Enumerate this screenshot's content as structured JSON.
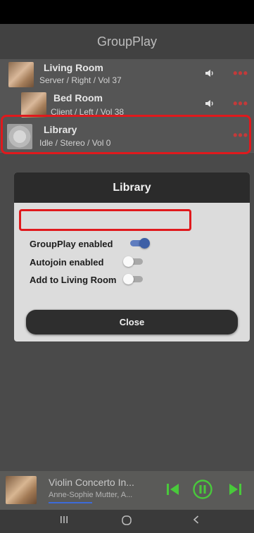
{
  "app": {
    "title": "GroupPlay"
  },
  "devices": [
    {
      "name": "Living Room",
      "status": "Server / Right / Vol 37",
      "thumb": "album-art"
    },
    {
      "name": "Bed Room",
      "status": "Client / Left / Vol 38",
      "thumb": "album-art"
    },
    {
      "name": "Library",
      "status": "Idle / Stereo / Vol 0",
      "thumb": "disc"
    }
  ],
  "row_icons": {
    "volume": "speaker-icon",
    "more": "more-dots-icon"
  },
  "dialog": {
    "title": "Library",
    "options": [
      {
        "label": "GroupPlay enabled",
        "enabled": true
      },
      {
        "label": "Autojoin enabled",
        "enabled": false
      },
      {
        "label": "Add to Living Room",
        "enabled": false
      }
    ],
    "close_label": "Close"
  },
  "player": {
    "title": "Violin Concerto In...",
    "artist": "Anne-Sophie Mutter, A...",
    "state": "playing"
  },
  "colors": {
    "highlight": "#e0191d",
    "accent_green": "#49c93b",
    "toggle_on": "#3d5fa6",
    "more_dots": "#c33a3a"
  }
}
